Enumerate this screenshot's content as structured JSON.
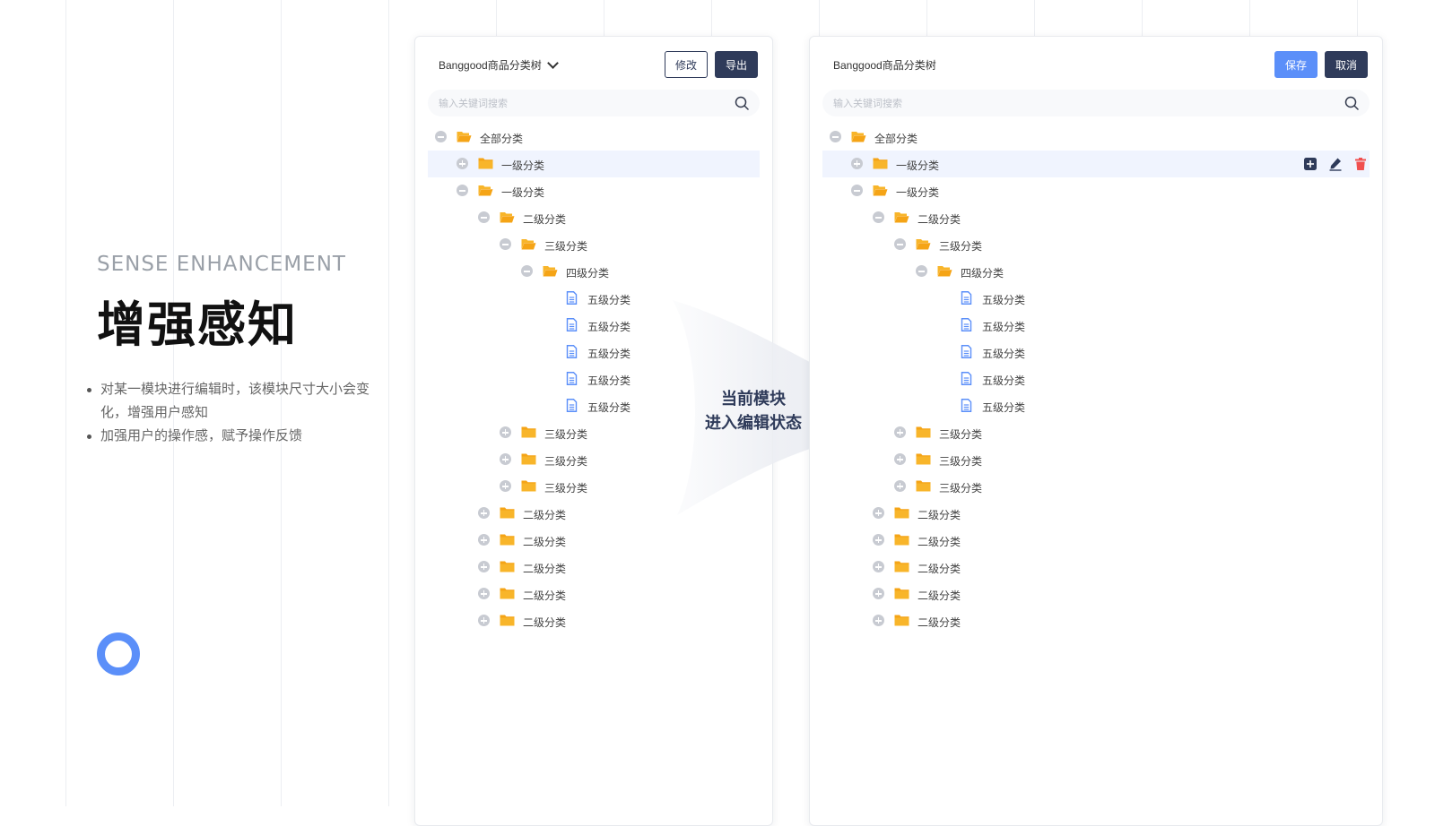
{
  "intro": {
    "kicker": "SENSE ENHANCEMENT",
    "title": "增强感知",
    "bullets": [
      "对某一模块进行编辑时，该模块尺寸大小会变化，增强用户感知",
      "加强用户的操作感，赋予操作反馈"
    ]
  },
  "colors": {
    "accent": "#5b8ff9",
    "dark_button": "#2f3b5a",
    "folder": "#f5a416",
    "file": "#5b8ff9",
    "delete": "#f0504f",
    "highlight_row": "#f0f4fe"
  },
  "left_panel": {
    "tree_name": "Banggood商品分类树",
    "edit_label": "修改",
    "export_label": "导出",
    "search_placeholder": "输入关键词搜索"
  },
  "right_panel": {
    "tree_name": "Banggood商品分类树",
    "save_label": "保存",
    "cancel_label": "取消",
    "search_placeholder": "输入关键词搜索",
    "row_actions": [
      "add-icon",
      "edit-icon",
      "delete-icon"
    ]
  },
  "transition": {
    "line1": "当前模块",
    "line2": "进入编辑状态"
  },
  "tree": [
    {
      "level": 0,
      "label": "全部分类",
      "type": "folder-open",
      "expander": "minus"
    },
    {
      "level": 1,
      "label": "一级分类",
      "type": "folder",
      "expander": "plus",
      "highlighted": true
    },
    {
      "level": 1,
      "label": "一级分类",
      "type": "folder-open",
      "expander": "minus"
    },
    {
      "level": 2,
      "label": "二级分类",
      "type": "folder-open",
      "expander": "minus"
    },
    {
      "level": 3,
      "label": "三级分类",
      "type": "folder-open",
      "expander": "minus"
    },
    {
      "level": 4,
      "label": "四级分类",
      "type": "folder-open",
      "expander": "minus"
    },
    {
      "level": 5,
      "label": "五级分类",
      "type": "file",
      "expander": "none"
    },
    {
      "level": 5,
      "label": "五级分类",
      "type": "file",
      "expander": "none"
    },
    {
      "level": 5,
      "label": "五级分类",
      "type": "file",
      "expander": "none"
    },
    {
      "level": 5,
      "label": "五级分类",
      "type": "file",
      "expander": "none"
    },
    {
      "level": 5,
      "label": "五级分类",
      "type": "file",
      "expander": "none"
    },
    {
      "level": 3,
      "label": "三级分类",
      "type": "folder",
      "expander": "plus"
    },
    {
      "level": 3,
      "label": "三级分类",
      "type": "folder",
      "expander": "plus"
    },
    {
      "level": 3,
      "label": "三级分类",
      "type": "folder",
      "expander": "plus"
    },
    {
      "level": 2,
      "label": "二级分类",
      "type": "folder",
      "expander": "plus"
    },
    {
      "level": 2,
      "label": "二级分类",
      "type": "folder",
      "expander": "plus"
    },
    {
      "level": 2,
      "label": "二级分类",
      "type": "folder",
      "expander": "plus"
    },
    {
      "level": 2,
      "label": "二级分类",
      "type": "folder",
      "expander": "plus"
    },
    {
      "level": 2,
      "label": "二级分类",
      "type": "folder",
      "expander": "plus"
    }
  ]
}
